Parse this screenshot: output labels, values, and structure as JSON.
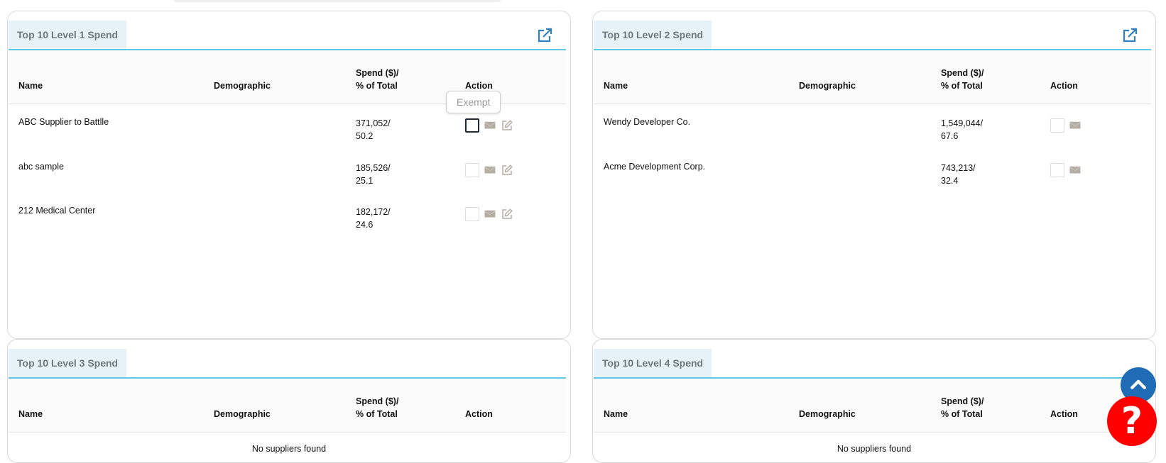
{
  "tooltip": {
    "text": "Exempt"
  },
  "columns": {
    "name": "Name",
    "demographic": "Demographic",
    "spend_line1": "Spend ($)/",
    "spend_line2": "% of Total",
    "action": "Action"
  },
  "panels": [
    {
      "title": "Top 10 Level 1 Spend",
      "rows": [
        {
          "name": "ABC Supplier to Battlle",
          "demographic": "",
          "spend": "371,052/",
          "percent": "50.2",
          "actions": [
            "exempt-checkbox",
            "mail-icon",
            "edit-icon"
          ]
        },
        {
          "name": "abc sample",
          "demographic": "",
          "spend": "185,526/",
          "percent": "25.1",
          "actions": [
            "exempt-checkbox",
            "mail-icon",
            "edit-icon"
          ]
        },
        {
          "name": "212 Medical Center",
          "demographic": "",
          "spend": "182,172/",
          "percent": "24.6",
          "actions": [
            "exempt-checkbox",
            "mail-icon",
            "edit-icon"
          ]
        }
      ]
    },
    {
      "title": "Top 10 Level 2 Spend",
      "rows": [
        {
          "name": "Wendy Developer Co.",
          "demographic": "",
          "spend": "1,549,044/",
          "percent": "67.6",
          "actions": [
            "exempt-checkbox",
            "mail-icon"
          ]
        },
        {
          "name": "Acme Development Corp.",
          "demographic": "",
          "spend": "743,213/",
          "percent": "32.4",
          "actions": [
            "exempt-checkbox",
            "mail-icon"
          ]
        }
      ]
    },
    {
      "title": "Top 10 Level 3 Spend",
      "empty_text": "No suppliers found",
      "rows": []
    },
    {
      "title": "Top 10 Level 4 Spend",
      "empty_text": "No suppliers found",
      "rows": []
    }
  ],
  "icons": {
    "external_link": "external-link-icon",
    "mail": "envelope-icon",
    "edit": "edit-icon",
    "scroll_top": "chevron-up-icon",
    "help": "question-mark-icon"
  },
  "help": {
    "label": "?"
  },
  "colors": {
    "accent_line": "#5ec8e6",
    "title_bg": "#e6f2f8",
    "link_icon": "#2f7fc1",
    "action_icon": "#b3ada3",
    "scroll_button": "#1f6bb5",
    "help_button": "#ff0000"
  }
}
